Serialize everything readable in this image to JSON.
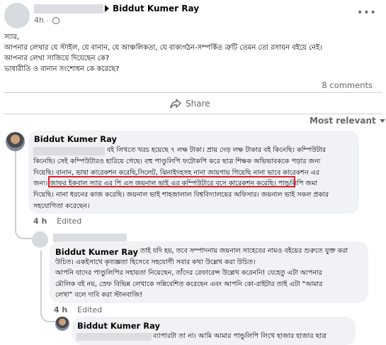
{
  "post": {
    "author": "Biddut Kumer Ray",
    "time": "4h",
    "lines": [
      "স্যার,",
      "আপনার লেখার যে স্টাইল, যে বানান, যে আঞ্চলিকতা, যে বাক্যগঠন-সম্পর্কিত ত্রুটি তেমন তো রসায়ন বইয়ে নেই।",
      "আপনার লেখা সাজিয়ে দিয়েছেন কে?",
      "ভাষারীতি ও বানান সংশোধন কে করেছে?"
    ],
    "comments_count": "8 comments",
    "share_label": "Share",
    "sort_label": "Most relevant"
  },
  "comments": [
    {
      "author": "Biddut Kumer Ray",
      "lines": [
        "বই লিখতে খরচ হয়েছে ৭ লক্ষ টাকা। প্রায় দেড় লক্ষ টাকার বই কিনেছি। কম্পিউটার",
        "কিনেছি। সেই কম্পিউটারও হারিয়ে গেছে। বহু পাণ্ডুলিপি ফটোকপি করে ছাত্র শিক্ষক অভিভাবককে পড়ার জন্য",
        "দিয়েছি। বানান, ভাষা কারেকশন করেছি,সিলেট, ঝিনাইদহসহ নানা জায়গায় গিয়েছি নানা ভাবে কারেকশন এর",
        "জন্য। জাফর ইকবাল স্যার এর পি এস জয়নাল ভাই এর কম্পিউটারে বসে কারেকশন করেছি। পান্ডুলিপি জমা",
        "দিয়েছি। নানা ধরনের কাজ করেছি। জয়নাল ভাই শাহজালাল বিশ্ববিদ্যালয়ের অফিসার। জয়নাল ভাই সকল প্রকার",
        "সহযোগিতা করেছেন।"
      ],
      "time": "4 h",
      "edited": "Edited"
    },
    {
      "author": "Biddut Kumer Ray",
      "lines": [
        "তাই যদি হয়, তবে সম্পাদনায় জয়নাল সাহেবের নামও বইয়ের শুরুতে যুক্ত করা",
        "উচিত। একইসাথে কৃতজ্ঞতা হিসেবে সহযোগী সবার কথা উল্লেখ করা উচিত।",
        "আপনি যাদের পাণ্ডুলিপির সহায়তা নিয়েছেন, তাঁদের রেফারেন্স উল্লেখ করেননি! যেহেতু এটা আপনার",
        "মৌলিক বই নয়, স্রেফ বিভিন্ন লেখাকে সন্নিবেশিত করেছেন এবং আপনি কো-রাইটার তাই এটা \"আমার",
        "লেখা\" বলে দাবি করা স্টানবাজি!"
      ],
      "time": "4 h",
      "edited": "Edited"
    },
    {
      "author": "Biddut Kumer Ray",
      "lines": [
        "ব্যাপারটা তা না। আমি আমার পান্ডুলিপি লিখে হাজার হাজার ছাত্র"
      ]
    }
  ],
  "colors": {
    "highlight": "#e0202a",
    "bubble": "#f0f2f5",
    "meta": "#65676b"
  }
}
